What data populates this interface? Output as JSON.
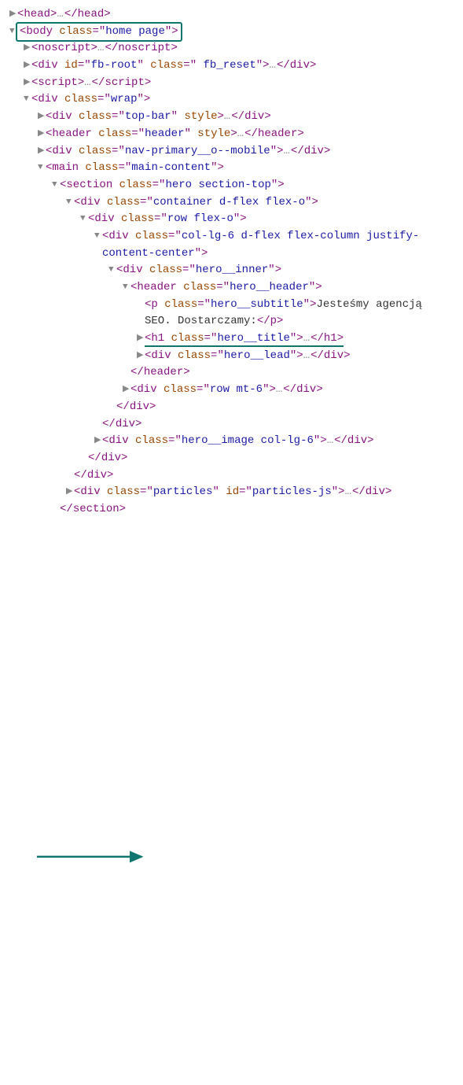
{
  "lines": [
    {
      "indent": 0,
      "toggle": "collapsed",
      "open": "head",
      "attrs": [],
      "collapsedContent": "…",
      "close": "head"
    },
    {
      "indent": 0,
      "toggle": "expanded",
      "open": "body",
      "attrs": [
        [
          "class",
          "home page"
        ]
      ],
      "highlightBox": true
    },
    {
      "indent": 1,
      "toggle": "collapsed",
      "open": "noscript",
      "attrs": [],
      "collapsedContent": "…",
      "close": "noscript"
    },
    {
      "indent": 1,
      "toggle": "collapsed",
      "open": "div",
      "attrs": [
        [
          "id",
          "fb-root"
        ],
        [
          "class",
          " fb_reset"
        ]
      ],
      "collapsedContent": "…",
      "close": "div"
    },
    {
      "indent": 1,
      "toggle": "collapsed",
      "open": "script",
      "attrs": [],
      "collapsedContent": "…",
      "close": "script"
    },
    {
      "indent": 1,
      "toggle": "expanded",
      "open": "div",
      "attrs": [
        [
          "class",
          "wrap"
        ]
      ]
    },
    {
      "indent": 2,
      "toggle": "collapsed",
      "open": "div",
      "attrs": [
        [
          "class",
          "top-bar"
        ],
        [
          "style",
          null
        ]
      ],
      "collapsedContent": "…",
      "close": "div"
    },
    {
      "indent": 2,
      "toggle": "collapsed",
      "open": "header",
      "attrs": [
        [
          "class",
          "header"
        ],
        [
          "style",
          null
        ]
      ],
      "collapsedContent": "…",
      "close": "header"
    },
    {
      "indent": 2,
      "toggle": "collapsed",
      "open": "div",
      "attrs": [
        [
          "class",
          "nav-primary__o--mobile"
        ]
      ],
      "collapsedContent": "…",
      "close": "div"
    },
    {
      "indent": 2,
      "toggle": "expanded",
      "open": "main",
      "attrs": [
        [
          "class",
          "main-content"
        ]
      ]
    },
    {
      "indent": 3,
      "toggle": "expanded",
      "open": "section",
      "attrs": [
        [
          "class",
          "hero section-top"
        ]
      ]
    },
    {
      "indent": 4,
      "toggle": "expanded",
      "open": "div",
      "attrs": [
        [
          "class",
          "container d-flex flex-o"
        ]
      ]
    },
    {
      "indent": 5,
      "toggle": "expanded",
      "open": "div",
      "attrs": [
        [
          "class",
          "row flex-o"
        ]
      ]
    },
    {
      "indent": 6,
      "toggle": "expanded",
      "open": "div",
      "attrs": [
        [
          "class",
          "col-lg-6 d-flex flex-column justify-content-center"
        ]
      ],
      "wrap": true
    },
    {
      "indent": 7,
      "toggle": "expanded",
      "open": "div",
      "attrs": [
        [
          "class",
          "hero__inner"
        ]
      ]
    },
    {
      "indent": 8,
      "toggle": "expanded",
      "open": "header",
      "attrs": [
        [
          "class",
          "hero__header"
        ]
      ]
    },
    {
      "indent": 9,
      "toggle": null,
      "open": "p",
      "attrs": [
        [
          "class",
          "hero__subtitle"
        ]
      ],
      "textContent": "Jesteśmy agencją SEO. Dostarczamy:",
      "close": "p",
      "wrap": true
    },
    {
      "indent": 9,
      "toggle": "collapsed",
      "open": "h1",
      "attrs": [
        [
          "class",
          "hero__title"
        ]
      ],
      "collapsedContent": "…",
      "close": "h1",
      "underline": true,
      "arrowTarget": true
    },
    {
      "indent": 9,
      "toggle": "collapsed",
      "open": "div",
      "attrs": [
        [
          "class",
          "hero__lead"
        ]
      ],
      "collapsedContent": "…",
      "close": "div"
    },
    {
      "indent": 8,
      "toggle": null,
      "closeOnly": "header"
    },
    {
      "indent": 8,
      "toggle": "collapsed",
      "open": "div",
      "attrs": [
        [
          "class",
          "row mt-6"
        ]
      ],
      "collapsedContent": "…",
      "close": "div"
    },
    {
      "indent": 7,
      "toggle": null,
      "closeOnly": "div"
    },
    {
      "indent": 6,
      "toggle": null,
      "closeOnly": "div"
    },
    {
      "indent": 6,
      "toggle": "collapsed",
      "open": "div",
      "attrs": [
        [
          "class",
          "hero__image col-lg-6"
        ]
      ],
      "collapsedContent": "…",
      "close": "div"
    },
    {
      "indent": 5,
      "toggle": null,
      "closeOnly": "div"
    },
    {
      "indent": 4,
      "toggle": null,
      "closeOnly": "div"
    },
    {
      "indent": 4,
      "toggle": "collapsed",
      "open": "div",
      "attrs": [
        [
          "class",
          "particles"
        ],
        [
          "id",
          "particles-js"
        ]
      ],
      "collapsedContent": "…",
      "close": "div"
    },
    {
      "indent": 3,
      "toggle": null,
      "closeOnly": "section"
    }
  ],
  "indentUnit": 18
}
